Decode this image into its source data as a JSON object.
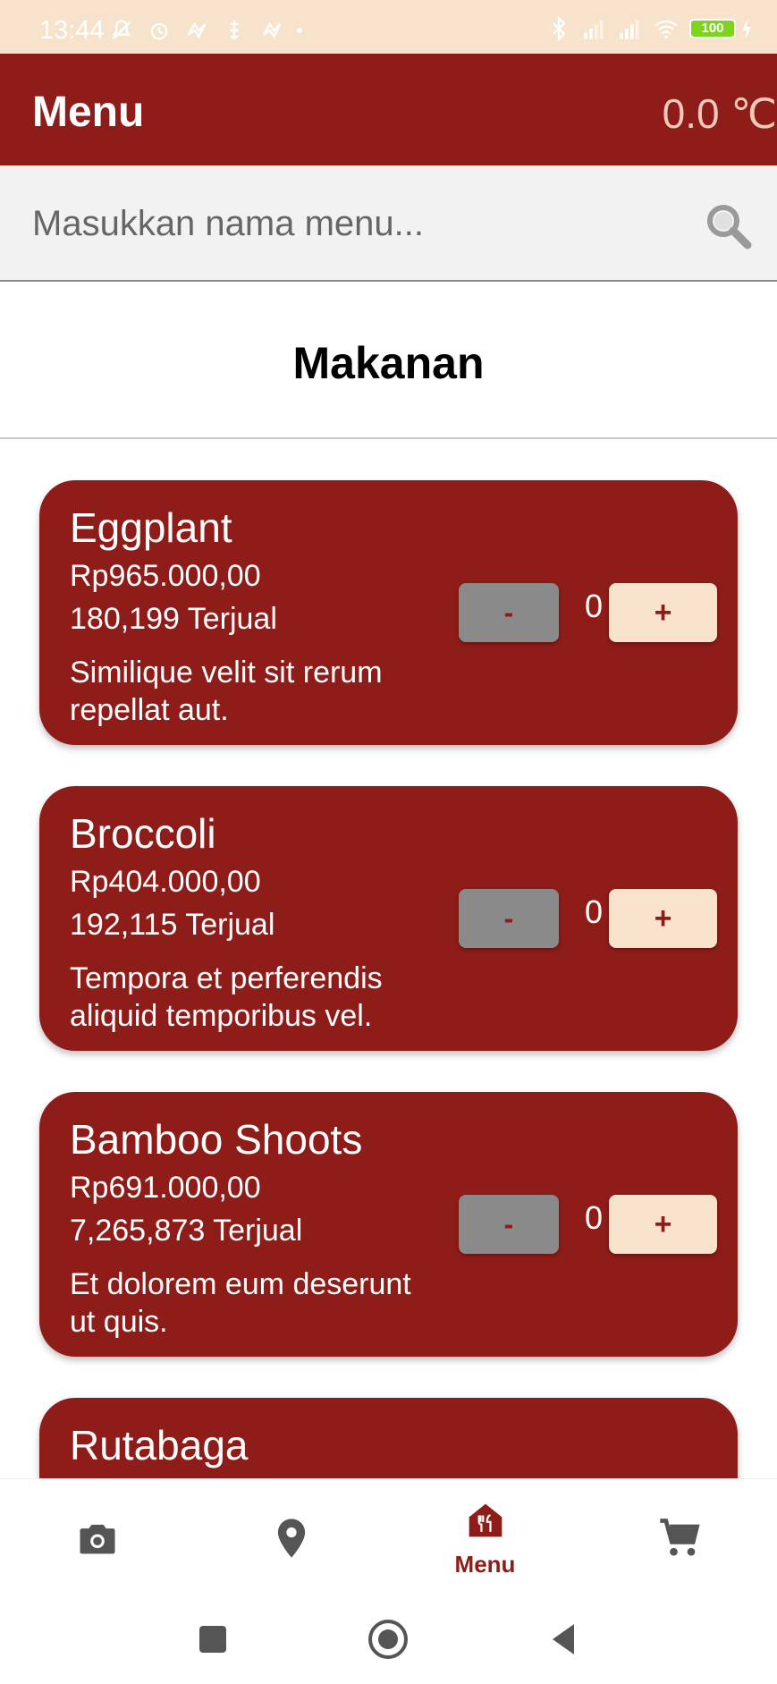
{
  "status_bar": {
    "time": "13:44",
    "battery": "100"
  },
  "app_bar": {
    "title": "Menu",
    "temperature": "0.0 ℃"
  },
  "search": {
    "placeholder": "Masukkan nama menu..."
  },
  "section": {
    "title": "Makanan"
  },
  "menu_items": [
    {
      "name": "Eggplant",
      "price": "Rp965.000,00",
      "sold": "180,199 Terjual",
      "description": "Similique velit sit rerum repellat aut.",
      "quantity": "0",
      "minus_label": "-",
      "plus_label": "+"
    },
    {
      "name": "Broccoli",
      "price": "Rp404.000,00",
      "sold": "192,115 Terjual",
      "description": "Tempora et perferendis aliquid temporibus vel.",
      "quantity": "0",
      "minus_label": "-",
      "plus_label": "+"
    },
    {
      "name": "Bamboo Shoots",
      "price": "Rp691.000,00",
      "sold": "7,265,873 Terjual",
      "description": "Et dolorem eum deserunt ut quis.",
      "quantity": "0",
      "minus_label": "-",
      "plus_label": "+"
    },
    {
      "name": "Rutabaga"
    }
  ],
  "bottom_nav": {
    "items": [
      {
        "icon": "camera-icon"
      },
      {
        "icon": "location-pin-icon"
      },
      {
        "icon": "restaurant-icon",
        "label": "Menu",
        "active": true
      },
      {
        "icon": "cart-icon"
      }
    ]
  },
  "colors": {
    "primary": "#8e1c19",
    "accent": "#f7e3cb",
    "minus_button": "#8a8a8a"
  }
}
